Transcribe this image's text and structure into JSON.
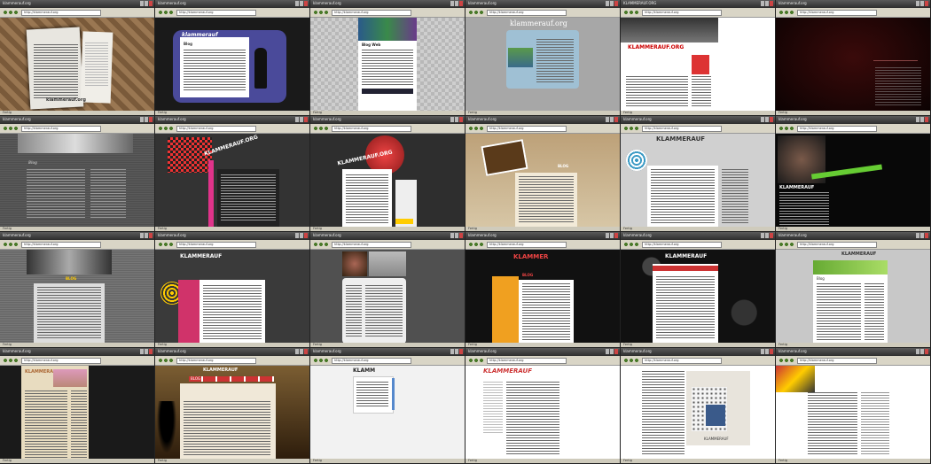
{
  "screens": [
    {
      "id": "s1",
      "window": "klammerauf.org",
      "url": "http://klammerauf.org",
      "status": "Fertig",
      "bg": "#8a6a4a",
      "brand": "klammerauf.org",
      "heading": "",
      "label": ""
    },
    {
      "id": "s2",
      "window": "klammerauf.org",
      "url": "http://klammerauf.org",
      "status": "Fertig",
      "bg": "#1a1a1a",
      "brand": "klammerauf",
      "heading": "Blog",
      "label": ""
    },
    {
      "id": "s3",
      "window": "klammerauf.org",
      "url": "http://klammerauf.org",
      "status": "Fertig",
      "bg": "#bfbfbf",
      "brand": "",
      "heading": "Blog Web",
      "label": ""
    },
    {
      "id": "s4",
      "window": "klammerauf.org",
      "url": "http://klammerauf.org",
      "status": "Fertig",
      "bg": "#a7a7a7",
      "brand": "klammerauf.org",
      "heading": "",
      "label": ""
    },
    {
      "id": "s5",
      "window": "KLAMMERAUF.ORG",
      "url": "http://klammerauf.org",
      "status": "Fertig",
      "bg": "#ffffff",
      "brand": "KLAMMERAUF.ORG",
      "heading": "",
      "label": ""
    },
    {
      "id": "s6",
      "window": "klammerauf.org",
      "url": "http://klammerauf.org",
      "status": "Fertig",
      "bg": "#120606",
      "brand": "",
      "heading": "",
      "label": ""
    },
    {
      "id": "s7",
      "window": "klammerauf.org",
      "url": "http://klammerauf.org",
      "status": "Fertig",
      "bg": "#555555",
      "brand": "",
      "heading": "Blog",
      "label": ""
    },
    {
      "id": "s8",
      "window": "klammerauf.org",
      "url": "http://klammerauf.org",
      "status": "Fertig",
      "bg": "#2a2a2a",
      "brand": "KLAMMERAUF.ORG",
      "heading": "",
      "label": ""
    },
    {
      "id": "s9",
      "window": "klammerauf.org",
      "url": "http://klammerauf.org",
      "status": "Fertig",
      "bg": "#2e2e2e",
      "brand": "KLAMMERAUF.ORG",
      "heading": "",
      "label": ""
    },
    {
      "id": "s10",
      "window": "klammerauf.org",
      "url": "http://klammerauf.org",
      "status": "Fertig",
      "bg": "#c9b391",
      "brand": "",
      "heading": "BLOG",
      "label": ""
    },
    {
      "id": "s11",
      "window": "klammerauf.org",
      "url": "http://klammerauf.org",
      "status": "Fertig",
      "bg": "#d0d0d0",
      "brand": "KLAMMERAUF",
      "heading": "",
      "label": ""
    },
    {
      "id": "s12",
      "window": "klammerauf.org",
      "url": "http://klammerauf.org",
      "status": "Fertig",
      "bg": "#080808",
      "brand": "KLAMMERAUF",
      "heading": "",
      "label": ""
    },
    {
      "id": "s13",
      "window": "klammerauf.org",
      "url": "http://klammerauf.org",
      "status": "Fertig",
      "bg": "#6a6a6a",
      "brand": "",
      "heading": "BLOG",
      "label": ""
    },
    {
      "id": "s14",
      "window": "klammerauf.org",
      "url": "http://klammerauf.org",
      "status": "Fertig",
      "bg": "#3a3a3a",
      "brand": "KLAMMERAUF",
      "heading": "",
      "label": ""
    },
    {
      "id": "s15",
      "window": "klammerauf.org",
      "url": "http://klammerauf.org",
      "status": "Fertig",
      "bg": "#505050",
      "brand": "",
      "heading": "",
      "label": ""
    },
    {
      "id": "s16",
      "window": "klammerauf.org",
      "url": "http://klammerauf.org",
      "status": "Fertig",
      "bg": "#111111",
      "brand": "KLAMMER",
      "heading": "BLOG",
      "label": ""
    },
    {
      "id": "s17",
      "window": "klammerauf.org",
      "url": "http://klammerauf.org",
      "status": "Fertig",
      "bg": "#111111",
      "brand": "KLAMMERAUF",
      "heading": "",
      "label": ""
    },
    {
      "id": "s18",
      "window": "klammerauf.org",
      "url": "http://klammerauf.org",
      "status": "Fertig",
      "bg": "#c8c8c8",
      "brand": "KLAMMERAUF",
      "heading": "Blog",
      "label": ""
    },
    {
      "id": "s19",
      "window": "klammerauf.org",
      "url": "http://klammerauf.org",
      "status": "Fertig",
      "bg": "#1a1a1a",
      "brand": "KLAMMERAUF",
      "heading": "",
      "label": ""
    },
    {
      "id": "s20",
      "window": "klammerauf.org",
      "url": "http://klammerauf.org",
      "status": "Fertig",
      "bg": "#9a7a4a",
      "brand": "KLAMMERAUF",
      "heading": "",
      "label": "BLOG"
    },
    {
      "id": "s21",
      "window": "klammerauf.org",
      "url": "http://klammerauf.org",
      "status": "Fertig",
      "bg": "#f2f2f2",
      "brand": "KLAMM",
      "heading": "",
      "label": ""
    },
    {
      "id": "s22",
      "window": "klammerauf.org",
      "url": "http://klammerauf.org",
      "status": "Fertig",
      "bg": "#ffffff",
      "brand": "KLAMMERAUF",
      "heading": "",
      "label": ""
    },
    {
      "id": "s23",
      "window": "klammerauf.org",
      "url": "http://klammerauf.org",
      "status": "Fertig",
      "bg": "#ffffff",
      "brand": "",
      "heading": "",
      "label": "KLAMMERAUF"
    },
    {
      "id": "s24",
      "window": "klammerauf.org",
      "url": "http://klammerauf.org",
      "status": "Fertig",
      "bg": "#ffffff",
      "brand": "",
      "heading": "",
      "label": ""
    }
  ]
}
